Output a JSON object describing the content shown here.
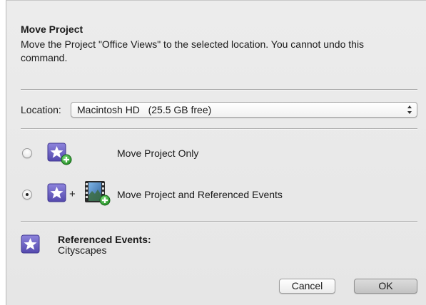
{
  "dialog": {
    "title": "Move Project",
    "message": "Move the Project \"Office Views\" to the selected location. You cannot undo this command."
  },
  "location": {
    "label": "Location:",
    "selected": "Macintosh HD   (25.5 GB free)"
  },
  "options": [
    {
      "label": "Move Project Only",
      "selected": false,
      "icons": [
        "project-star-icon",
        "add-badge-icon"
      ]
    },
    {
      "label": "Move Project and Referenced Events",
      "selected": true,
      "icons": [
        "project-star-icon",
        "film-event-icon",
        "add-badge-icon"
      ]
    }
  ],
  "plus_glyph": "+",
  "referenced": {
    "title": "Referenced Events:",
    "value": "Cityscapes"
  },
  "buttons": {
    "cancel": "Cancel",
    "ok": "OK"
  },
  "colors": {
    "star_icon_bg": "#6a5fc2",
    "add_badge": "#2f9e2f",
    "default_button": "#c8c8c8"
  }
}
